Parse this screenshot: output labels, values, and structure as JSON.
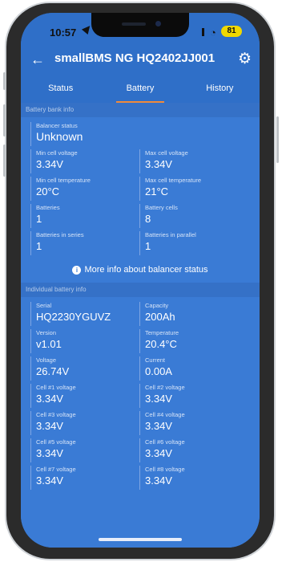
{
  "status_bar": {
    "time": "10:57",
    "battery_level": "81"
  },
  "app_bar": {
    "title": "smallBMS NG HQ2402JJ001"
  },
  "tabs": [
    {
      "label": "Status"
    },
    {
      "label": "Battery"
    },
    {
      "label": "History"
    }
  ],
  "bank": {
    "header": "Battery bank info",
    "balancer_label": "Balancer status",
    "balancer_value": "Unknown",
    "fields": [
      {
        "label": "Min cell voltage",
        "value": "3.34V"
      },
      {
        "label": "Max cell voltage",
        "value": "3.34V"
      },
      {
        "label": "Min cell temperature",
        "value": "20°C"
      },
      {
        "label": "Max cell temperature",
        "value": "21°C"
      },
      {
        "label": "Batteries",
        "value": "1"
      },
      {
        "label": "Battery cells",
        "value": "8"
      },
      {
        "label": "Batteries in series",
        "value": "1"
      },
      {
        "label": "Batteries in parallel",
        "value": "1"
      }
    ],
    "info_link": "More info about balancer status"
  },
  "individual": {
    "header": "Individual battery info",
    "fields": [
      {
        "label": "Serial",
        "value": "HQ2230YGUVZ"
      },
      {
        "label": "Capacity",
        "value": "200Ah"
      },
      {
        "label": "Version",
        "value": "v1.01"
      },
      {
        "label": "Temperature",
        "value": "20.4°C"
      },
      {
        "label": "Voltage",
        "value": "26.74V"
      },
      {
        "label": "Current",
        "value": "0.00A"
      },
      {
        "label": "Cell #1 voltage",
        "value": "3.34V"
      },
      {
        "label": "Cell #2 voltage",
        "value": "3.34V"
      },
      {
        "label": "Cell #3 voltage",
        "value": "3.34V"
      },
      {
        "label": "Cell #4 voltage",
        "value": "3.34V"
      },
      {
        "label": "Cell #5 voltage",
        "value": "3.34V"
      },
      {
        "label": "Cell #6 voltage",
        "value": "3.34V"
      },
      {
        "label": "Cell #7 voltage",
        "value": "3.34V"
      },
      {
        "label": "Cell #8 voltage",
        "value": "3.34V"
      }
    ]
  },
  "colors": {
    "primary": "#3a7bd5",
    "bar": "#2f6fc8",
    "accent": "#f08a3a"
  },
  "icons": {
    "back": "back-arrow-icon",
    "settings": "gear-icon",
    "info": "info-icon"
  }
}
